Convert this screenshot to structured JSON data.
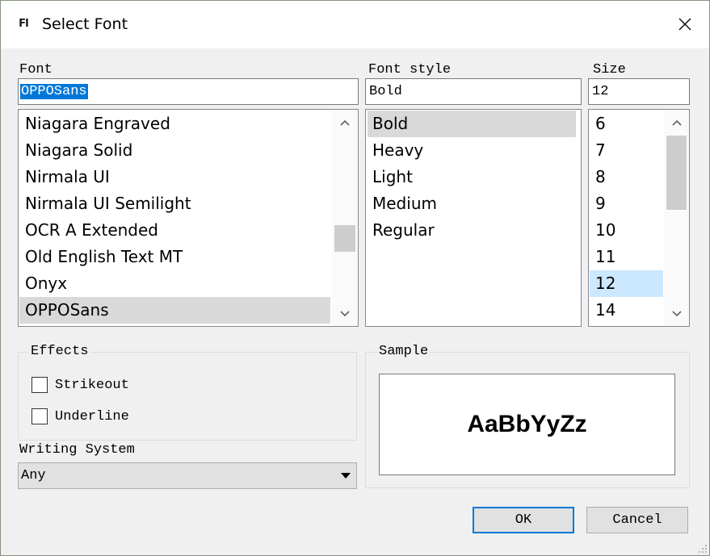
{
  "window": {
    "title": "Select Font",
    "app_icon_text": "FI"
  },
  "font": {
    "label": "Font",
    "value": "OPPOSans",
    "items": [
      "Niagara Engraved",
      "Niagara Solid",
      "Nirmala UI",
      "Nirmala UI Semilight",
      "OCR A Extended",
      "Old English Text MT",
      "Onyx",
      "OPPOSans"
    ],
    "selected_index": 7,
    "scrollbar": {
      "position": 0.65,
      "visible_fraction": 0.16
    }
  },
  "font_style": {
    "label": "Font style",
    "value": "Bold",
    "items": [
      "Bold",
      "Heavy",
      "Light",
      "Medium",
      "Regular"
    ],
    "selected_index": 0
  },
  "size": {
    "label": "Size",
    "value": "12",
    "items": [
      "6",
      "7",
      "8",
      "9",
      "10",
      "11",
      "12",
      "14"
    ],
    "selected_index": 6,
    "scrollbar": {
      "position": 0.0,
      "visible_fraction": 0.45
    }
  },
  "effects": {
    "title": "Effects",
    "strikeout": {
      "label": "Strikeout",
      "checked": false
    },
    "underline": {
      "label": "Underline",
      "checked": false
    }
  },
  "writing_system": {
    "label": "Writing System",
    "value": "Any"
  },
  "sample": {
    "title": "Sample",
    "text": "AaBbYyZz"
  },
  "buttons": {
    "ok": "OK",
    "cancel": "Cancel",
    "ok_is_default": true
  },
  "icons": {
    "close": "close-icon",
    "scroll_up": "chevron-up-icon",
    "scroll_down": "chevron-down-icon",
    "dropdown": "dropdown-arrow-icon",
    "checkmark": "checkmark-icon",
    "resize": "size-grip-icon"
  },
  "colors": {
    "dialog_background": "#f0f0f0",
    "text_selection": "#0078d7",
    "list_selection": "#d9d9d9",
    "size_highlight": "#cce8ff",
    "default_button_border": "#0078d7"
  }
}
